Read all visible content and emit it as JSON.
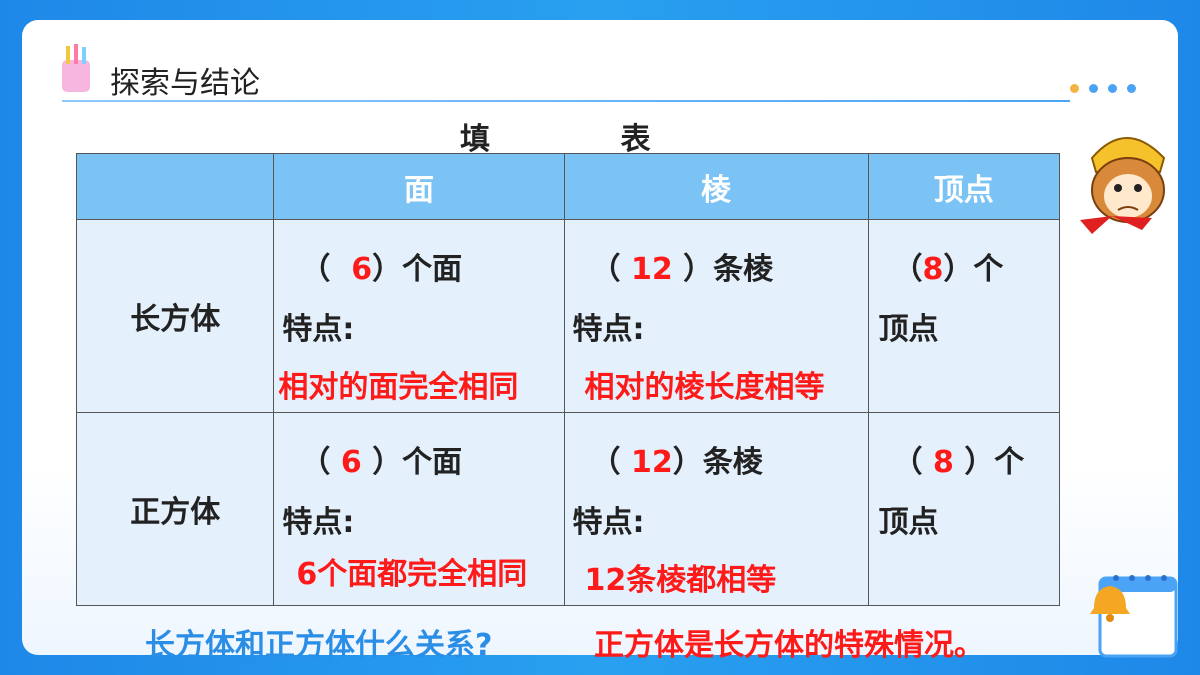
{
  "header": {
    "title": "探索与结论"
  },
  "table": {
    "title": "填  表",
    "columns": [
      "面",
      "棱",
      "顶点"
    ],
    "rows": [
      {
        "label": "长方体",
        "face": {
          "pre": "（",
          "num": "6",
          "post": "）个面",
          "feature_label": "特点:",
          "feature": "相对的面完全相同"
        },
        "edge": {
          "pre": "（",
          "num": "12",
          "post": "）条棱",
          "feature_label": "特点:",
          "feature": "相对的棱长度相等"
        },
        "vertex": {
          "pre": "（",
          "num": "8",
          "post": "）个",
          "line2": "顶点"
        }
      },
      {
        "label": "正方体",
        "face": {
          "pre": "（",
          "num": "6",
          "post": "）个面",
          "feature_label": "特点:",
          "feature": "6个面都完全相同"
        },
        "edge": {
          "pre": "（",
          "num": "12",
          "post": "）条棱",
          "feature_label": "特点:",
          "feature": "12条棱都相等"
        },
        "vertex": {
          "pre": "（",
          "num": "8",
          "post": "）个",
          "line2": "顶点"
        }
      }
    ]
  },
  "footer": {
    "question": "长方体和正方体什么关系?",
    "answer": "正方体是长方体的特殊情况。"
  },
  "colors": {
    "accent": "#7cc3f5",
    "answer_red": "#ff1a1a",
    "question_blue": "#2a8ee6"
  },
  "icons": [
    "pencil-holder-icon",
    "monkey-mascot-icon",
    "calendar-bell-icon"
  ]
}
